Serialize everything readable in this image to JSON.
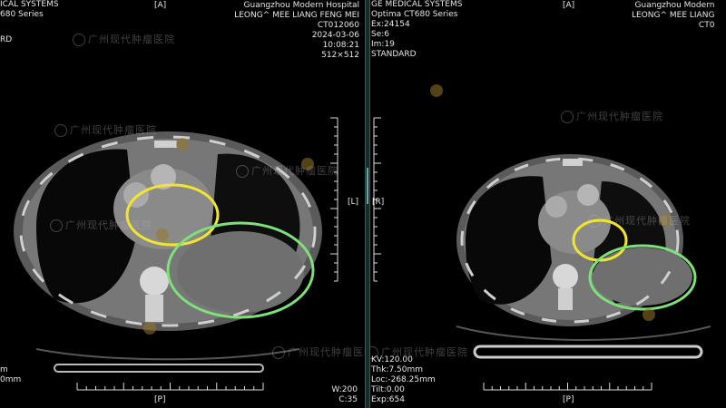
{
  "left_pane": {
    "top_left": [
      "ICAL SYSTEMS",
      "680 Series",
      "",
      "RD"
    ],
    "orientation_top": "[A]",
    "top_right": [
      "Guangzhou Modern Hospital",
      "LEONG^ MEE  LIANG FENG MEI",
      "CT012060",
      "2024-03-06",
      "10:08:21",
      "512×512"
    ],
    "orientation_side": "[L]",
    "orientation_bottom": "[P]",
    "bottom_left": [
      "m",
      "0mm"
    ],
    "bottom_right": [
      "W:200",
      "C:35"
    ],
    "watermark": "广州现代肿瘤医院"
  },
  "right_pane": {
    "top_left": [
      "GE MEDICAL SYSTEMS",
      "Optima CT680 Series",
      "Ex:24154",
      "Se:6",
      "Im:19",
      "STANDARD"
    ],
    "orientation_top": "[A]",
    "top_right": [
      "Guangzhou Modern",
      "LEONG^ MEE  LIANG",
      "CT0"
    ],
    "orientation_side": "[R]",
    "orientation_bottom": "[P]",
    "bottom_left": [
      "KV:120.00",
      "Thk:7.50mm",
      "Loc:-268.25mm",
      "Tilt:0.00",
      "Exp:654"
    ],
    "watermark": "广州现代肿瘤医院"
  },
  "annotations": {
    "yellow": "#f2e530",
    "green": "#7fe07a"
  }
}
